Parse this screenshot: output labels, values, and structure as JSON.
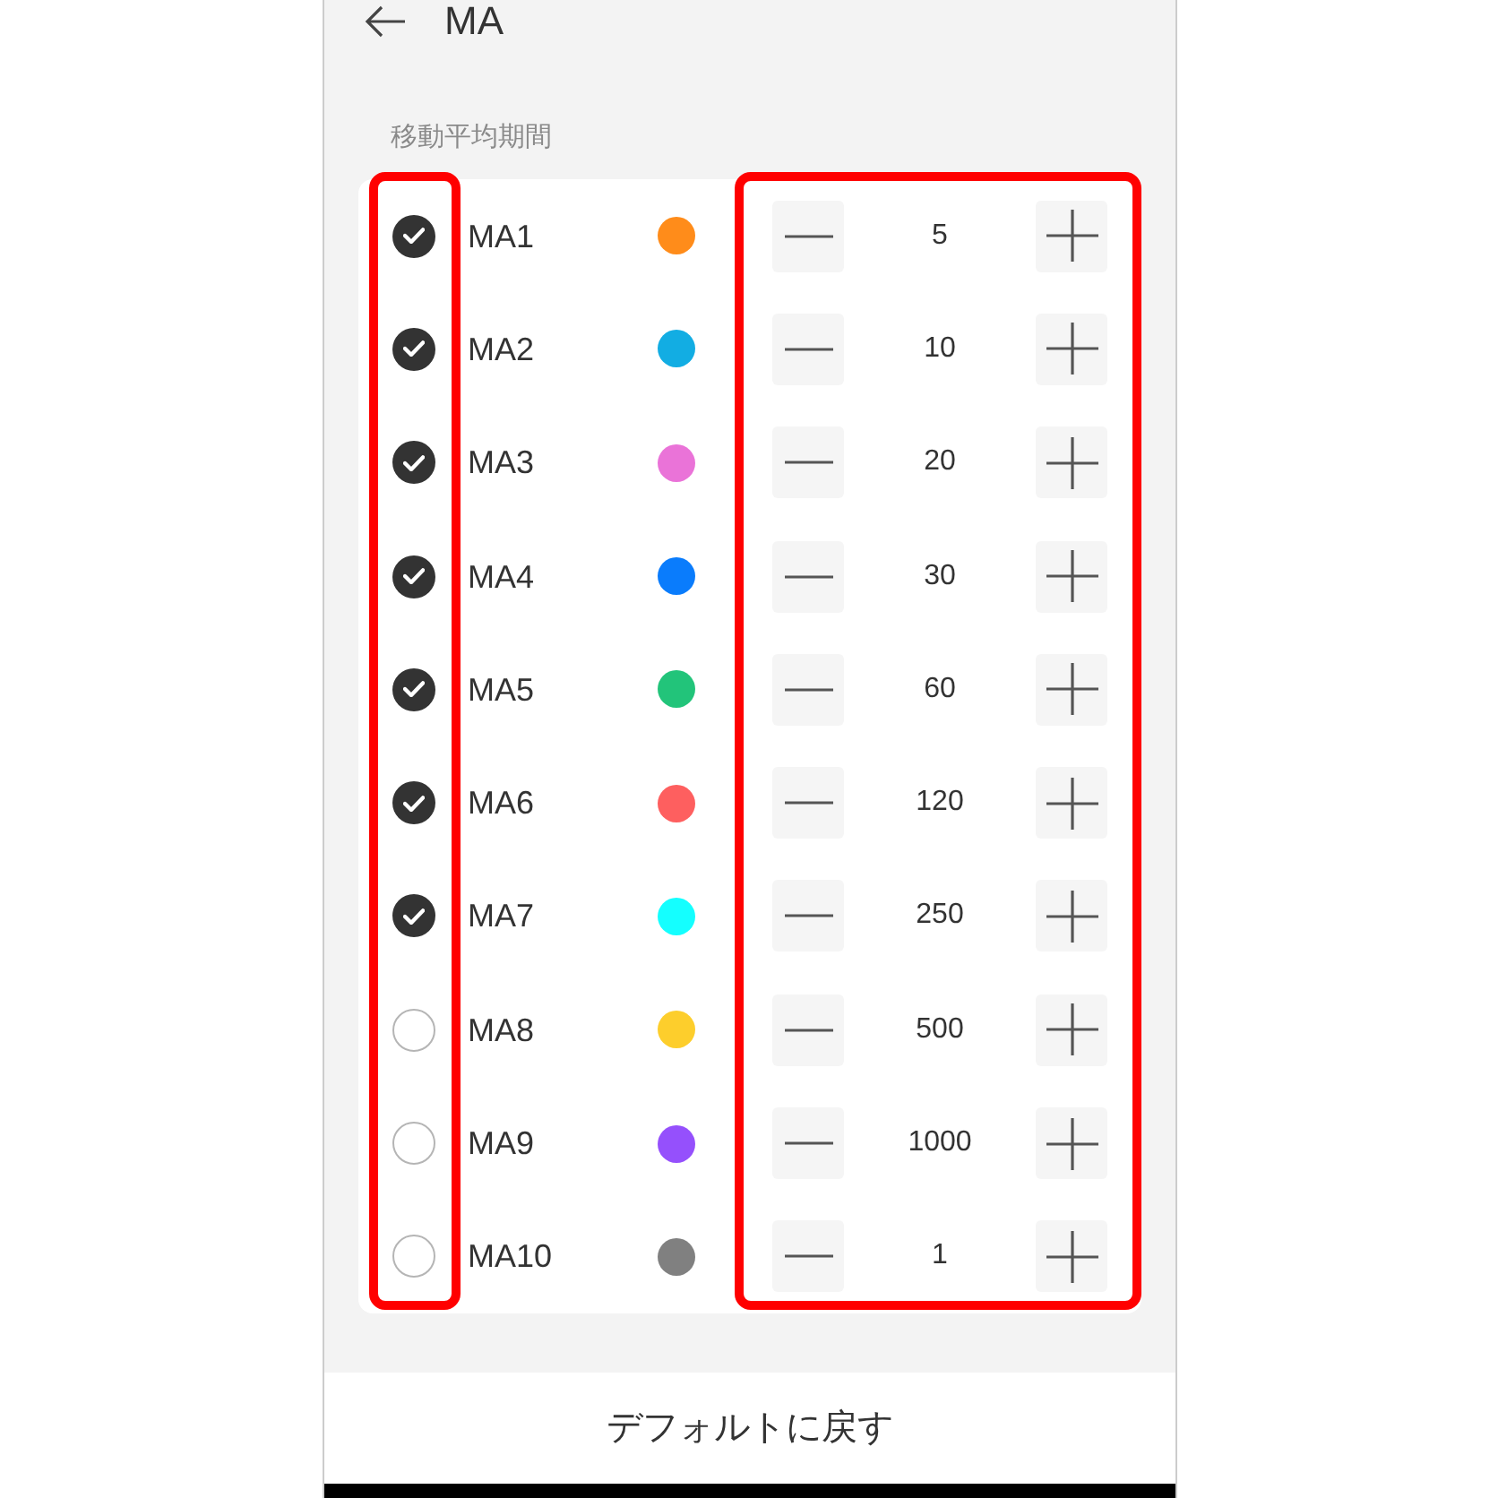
{
  "header": {
    "title": "MA"
  },
  "section": {
    "label": "移動平均期間"
  },
  "ma_lines": [
    {
      "name": "MA1",
      "checked": true,
      "color": "#ff8c1a",
      "period": "5"
    },
    {
      "name": "MA2",
      "checked": true,
      "color": "#12ade3",
      "period": "10"
    },
    {
      "name": "MA3",
      "checked": true,
      "color": "#ea73d8",
      "period": "20"
    },
    {
      "name": "MA4",
      "checked": true,
      "color": "#0a7cfc",
      "period": "30"
    },
    {
      "name": "MA5",
      "checked": true,
      "color": "#22c47a",
      "period": "60"
    },
    {
      "name": "MA6",
      "checked": true,
      "color": "#fe5f5f",
      "period": "120"
    },
    {
      "name": "MA7",
      "checked": true,
      "color": "#14ffff",
      "period": "250"
    },
    {
      "name": "MA8",
      "checked": false,
      "color": "#fdce2c",
      "period": "500"
    },
    {
      "name": "MA9",
      "checked": false,
      "color": "#9550fc",
      "period": "1000"
    },
    {
      "name": "MA10",
      "checked": false,
      "color": "#808080",
      "period": "1"
    }
  ],
  "reset_button": {
    "label": "デフォルトに戻す"
  }
}
